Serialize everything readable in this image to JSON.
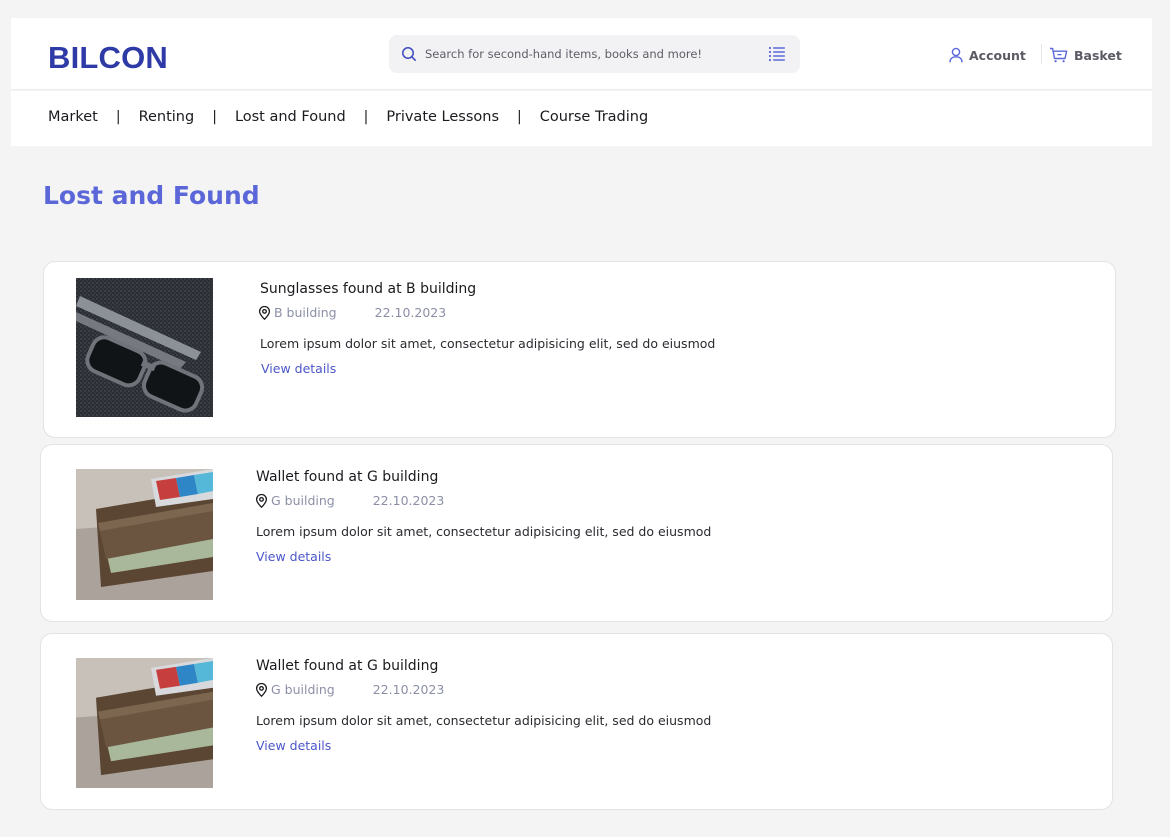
{
  "header": {
    "logo": "BILCON",
    "search_placeholder": "Search for second-hand items, books and more!",
    "account_label": "Account",
    "basket_label": "Basket"
  },
  "nav": {
    "items": [
      "Market",
      "Renting",
      "Lost and Found",
      "Private Lessons",
      "Course Trading"
    ],
    "separator": "|"
  },
  "page": {
    "title": "Lost and Found"
  },
  "listings": [
    {
      "title": "Sunglasses found at B building",
      "location": "B building",
      "date": "22.10.2023",
      "description": "Lorem ipsum dolor sit amet, consectetur adipisicing elit, sed do eiusmod",
      "link": "View details",
      "image": "sunglasses-photo"
    },
    {
      "title": "Wallet found at G building",
      "location": "G building",
      "date": "22.10.2023",
      "description": "Lorem ipsum dolor sit amet, consectetur adipisicing elit, sed do eiusmod",
      "link": "View details",
      "image": "wallet-photo"
    },
    {
      "title": "Wallet found at G building",
      "location": "G building",
      "date": "22.10.2023",
      "description": "Lorem ipsum dolor sit amet, consectetur adipisicing elit, sed do eiusmod",
      "link": "View details",
      "image": "wallet-photo"
    }
  ],
  "icons": {
    "search": "search-icon",
    "filter": "filter-list-icon",
    "account": "user-icon",
    "basket": "cart-icon",
    "location": "location-pin-icon"
  },
  "colors": {
    "brand": "#2e3aa6",
    "accent": "#5b67d8",
    "link": "#4b56c9",
    "meta": "#8b8fa6",
    "background": "#f4f4f5"
  }
}
